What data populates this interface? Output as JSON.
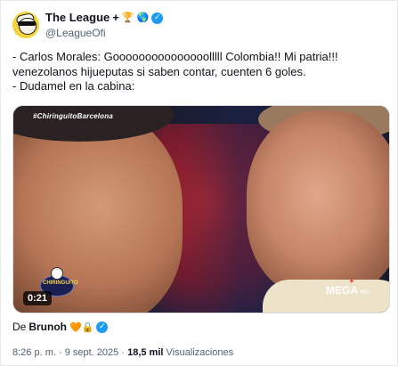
{
  "tweet": {
    "author_name": "The League",
    "author_suffix": "+",
    "author_emojis": [
      "🏆",
      "🌎"
    ],
    "handle": "@LeagueOfi",
    "verified_icon": "verified-badge-icon",
    "text_lines": [
      "- Carlos Morales: Gooooooooooooooolllll Colombia!! Mi patria!!!",
      "venezolanos hijueputas si saben contar, cuenten 6 goles.",
      " - Dudamel en la cabina:"
    ]
  },
  "media": {
    "tag": "#ChiringuitoBarcelona",
    "duration": "0:21",
    "logo_left_text": "CHIRINGUITO",
    "logo_right_text": "MEGA",
    "logo_right_sub": "HD"
  },
  "attribution": {
    "prefix": "De",
    "user": "Brunoh",
    "emojis": "🧡🔒"
  },
  "meta": {
    "time": "8:26 p. m.",
    "separator": "·",
    "date": "9 sept. 2025",
    "views_count": "18,5 mil",
    "views_label": "Visualizaciones"
  },
  "colors": {
    "verified": "#1d9bf0",
    "secondary_text": "#536471",
    "primary_text": "#0f1419"
  }
}
